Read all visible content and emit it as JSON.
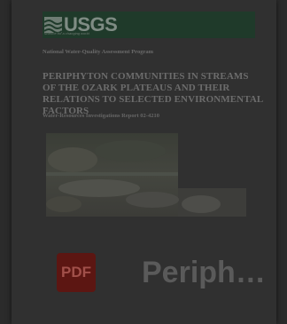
{
  "cover": {
    "agency": "USGS",
    "agency_tagline": "science for a changing world",
    "program": "National Water-Quality Assessment Program",
    "title": "PERIPHYTON COMMUNITIES IN STREAMS OF THE OZARK PLATEAUS AND THEIR RELATIONS TO SELECTED ENVIRONMENTAL FACTORS",
    "report": "Water-Resources Investigations Report 02-4210"
  },
  "file": {
    "type_badge": "PDF",
    "name": "Periphyton"
  },
  "colors": {
    "banner": "#1f3a2a",
    "pdf_badge": "#5c1612"
  }
}
